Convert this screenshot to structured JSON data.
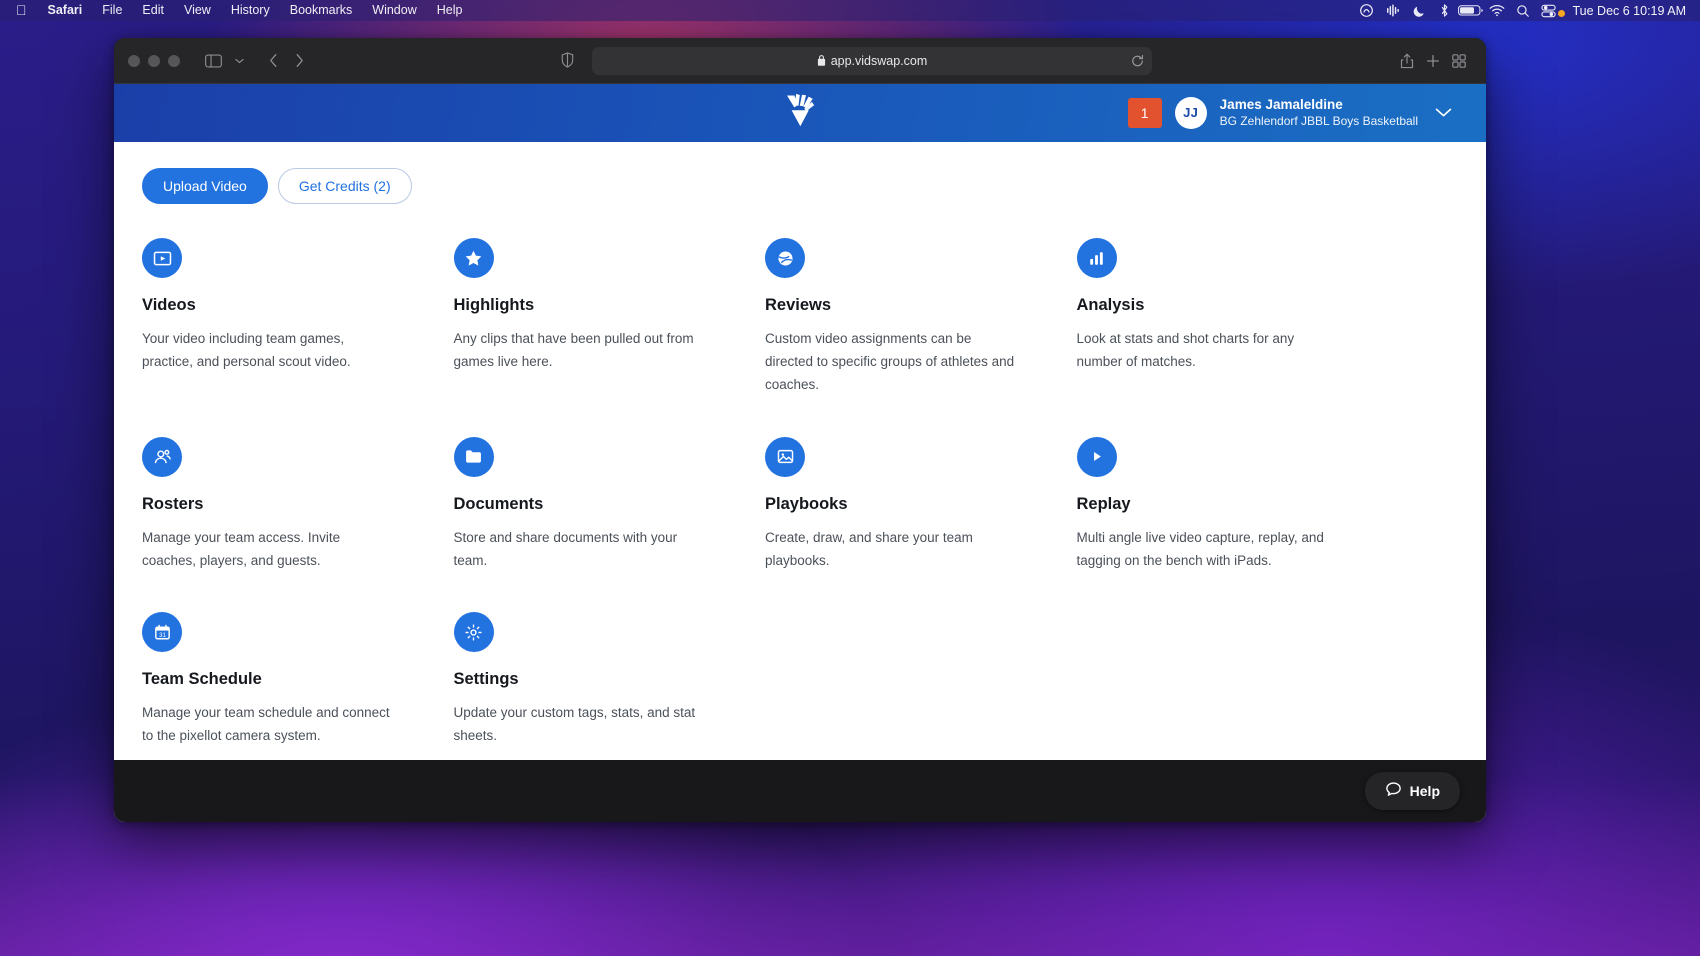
{
  "menubar": {
    "apple_icon": "apple-logo",
    "items": [
      {
        "label": "Safari",
        "bold": true
      },
      {
        "label": "File",
        "bold": false
      },
      {
        "label": "Edit",
        "bold": false
      },
      {
        "label": "View",
        "bold": false
      },
      {
        "label": "History",
        "bold": false
      },
      {
        "label": "Bookmarks",
        "bold": false
      },
      {
        "label": "Window",
        "bold": false
      },
      {
        "label": "Help",
        "bold": false
      }
    ],
    "status_icons": [
      "adobe-creative-cloud-icon",
      "audio-meter-icon",
      "do-not-disturb-moon-icon",
      "bluetooth-icon",
      "battery-icon",
      "wifi-icon",
      "spotlight-search-icon",
      "control-center-icon"
    ],
    "clock": "Tue Dec 6  10:19 AM"
  },
  "safari": {
    "traffic_lights": [
      "close",
      "minimize",
      "zoom"
    ],
    "sidebar_icon": "sidebar-toggle-icon",
    "sidebar_chevron_icon": "chevron-down-icon",
    "back_icon": "back-arrow-icon",
    "forward_icon": "forward-arrow-icon",
    "shield_icon": "privacy-shield-icon",
    "lock_icon": "lock-icon",
    "url": "app.vidswap.com",
    "reload_icon": "reload-icon",
    "share_icon": "share-icon",
    "new_tab_icon": "plus-icon",
    "tab_overview_icon": "tab-overview-icon"
  },
  "header": {
    "logo": "vidswap-logo",
    "notification_count": "1",
    "avatar_initials": "JJ",
    "user_name": "James Jamaleldine",
    "user_team": "BG Zehlendorf JBBL Boys Basketball",
    "chevron_icon": "chevron-down-icon",
    "accent_color": "#1a54b8",
    "badge_color": "#e2522e"
  },
  "actions": {
    "upload_label": "Upload Video",
    "credits_label": "Get Credits (2)",
    "primary_color": "#2272e0"
  },
  "cards": [
    {
      "icon": "video-play-icon",
      "title": "Videos",
      "desc": "Your video including team games, practice, and personal scout video."
    },
    {
      "icon": "star-icon",
      "title": "Highlights",
      "desc": "Any clips that have been pulled out from games live here."
    },
    {
      "icon": "whistle-icon",
      "title": "Reviews",
      "desc": "Custom video assignments can be directed to specific groups of athletes and coaches."
    },
    {
      "icon": "bar-chart-icon",
      "title": "Analysis",
      "desc": "Look at stats and shot charts for any number of matches."
    },
    {
      "icon": "people-icon",
      "title": "Rosters",
      "desc": "Manage your team access. Invite coaches, players, and guests."
    },
    {
      "icon": "folder-icon",
      "title": "Documents",
      "desc": "Store and share documents with your team."
    },
    {
      "icon": "image-icon",
      "title": "Playbooks",
      "desc": "Create, draw, and share your team playbooks."
    },
    {
      "icon": "play-circle-icon",
      "title": "Replay",
      "desc": "Multi angle live video capture, replay, and tagging on the bench with iPads."
    },
    {
      "icon": "calendar-icon",
      "title": "Team Schedule",
      "desc": "Manage your team schedule and connect to the pixellot camera system."
    },
    {
      "icon": "gear-icon",
      "title": "Settings",
      "desc": "Update your custom tags, stats, and stat sheets."
    }
  ],
  "footer": {
    "help_label": "Help",
    "help_icon": "speech-bubble-icon"
  }
}
